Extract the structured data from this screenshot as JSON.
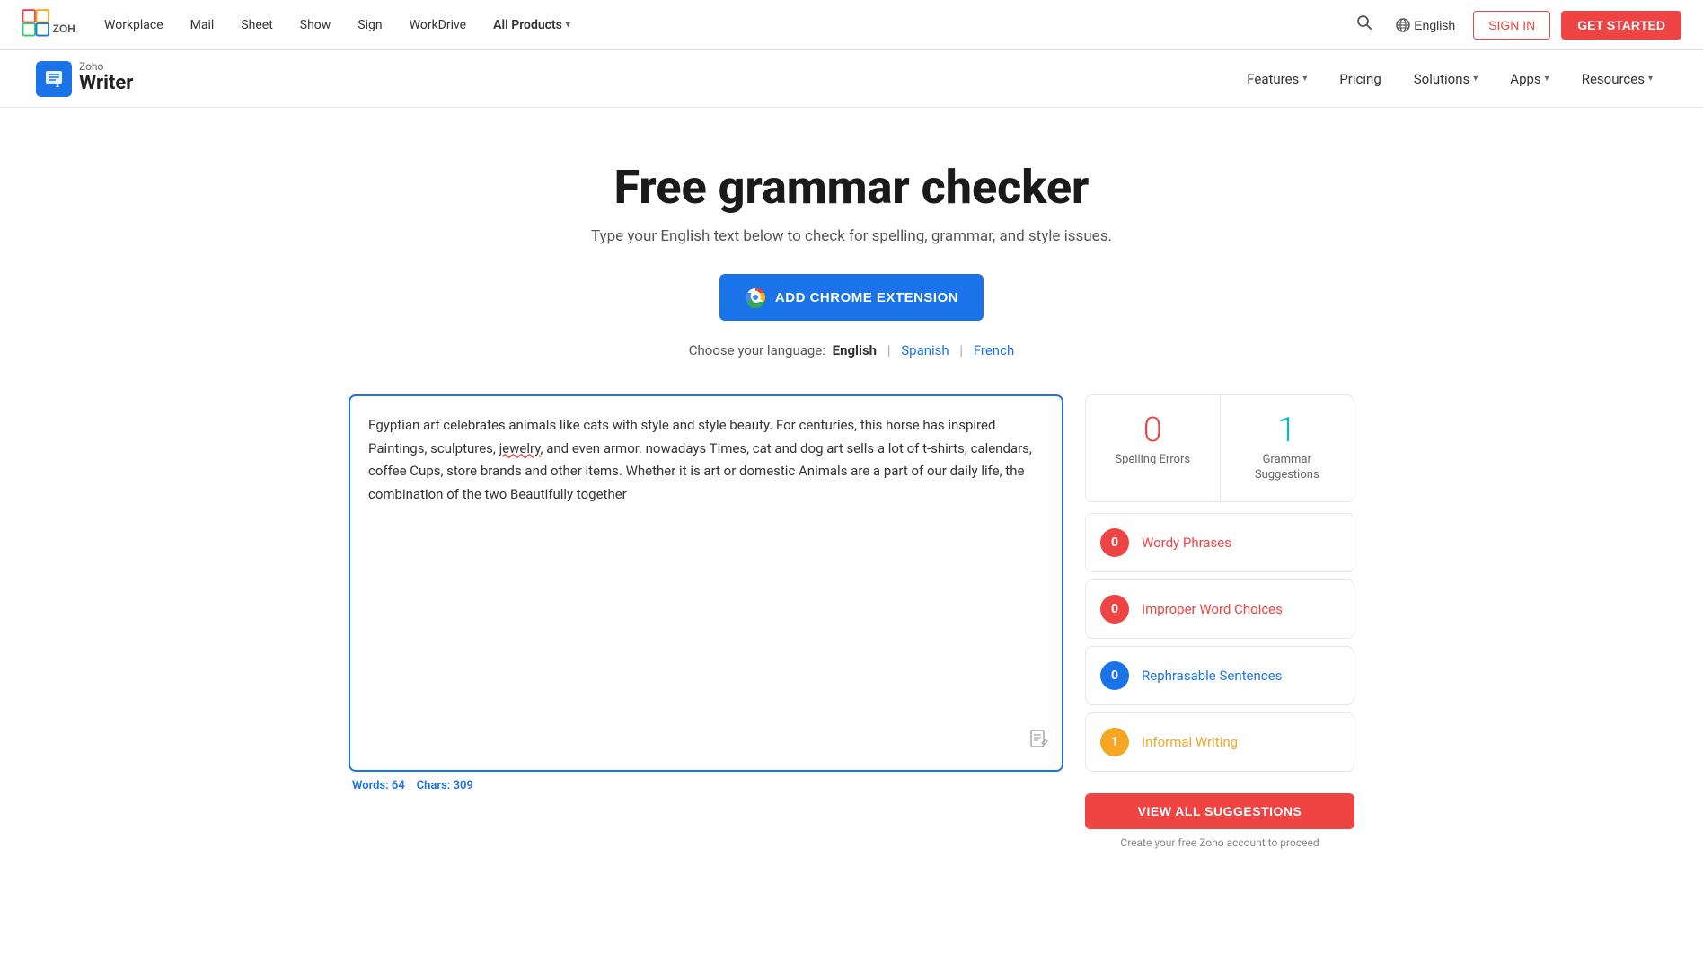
{
  "topNav": {
    "links": [
      {
        "id": "workplace",
        "label": "Workplace"
      },
      {
        "id": "mail",
        "label": "Mail"
      },
      {
        "id": "sheet",
        "label": "Sheet"
      },
      {
        "id": "show",
        "label": "Show"
      },
      {
        "id": "sign",
        "label": "Sign"
      },
      {
        "id": "workdrive",
        "label": "WorkDrive"
      },
      {
        "id": "all-products",
        "label": "All Products",
        "hasChevron": true
      }
    ],
    "searchLabel": "Search",
    "langLabel": "English",
    "signInLabel": "SIGN IN",
    "getStartedLabel": "GET STARTED"
  },
  "secondNav": {
    "brandZoho": "Zoho",
    "brandName": "Writer",
    "links": [
      {
        "id": "features",
        "label": "Features",
        "hasChevron": true
      },
      {
        "id": "pricing",
        "label": "Pricing"
      },
      {
        "id": "solutions",
        "label": "Solutions",
        "hasChevron": true
      },
      {
        "id": "apps",
        "label": "Apps",
        "hasChevron": true
      },
      {
        "id": "resources",
        "label": "Resources",
        "hasChevron": true
      }
    ]
  },
  "hero": {
    "title": "Free grammar checker",
    "subtitle": "Type your English text below to check for spelling, grammar, and style issues.",
    "chromeExtLabel": "ADD CHROME EXTENSION",
    "languageSelectorLabel": "Choose your language:",
    "selectedLang": "English",
    "otherLangs": [
      {
        "id": "spanish",
        "label": "Spanish"
      },
      {
        "id": "french",
        "label": "French"
      }
    ]
  },
  "editor": {
    "content": "Egyptian art celebrates animals like cats with style and style beauty. For centuries, this horse has inspired Paintings, sculptures, jewelry, and even armor. nowadays Times, cat and dog art sells a lot of t-shirts, calendars, coffee Cups, store brands and other items. Whether it is art or domestic Animals are a part of our daily life, the combination of the two Beautifully together",
    "wordCount": "64",
    "charCount": "309",
    "wordsLabel": "Words:",
    "charsLabel": "Chars:"
  },
  "stats": {
    "spellingErrors": "0",
    "spellingLabel": "Spelling Errors",
    "grammarSuggestions": "1",
    "grammarLabel": "Grammar Suggestions"
  },
  "suggestions": [
    {
      "id": "wordy",
      "count": "0",
      "label": "Wordy Phrases",
      "colorClass": "red",
      "labelClass": ""
    },
    {
      "id": "improper",
      "count": "0",
      "label": "Improper Word Choices",
      "colorClass": "red",
      "labelClass": ""
    },
    {
      "id": "rephrasable",
      "count": "0",
      "label": "Rephrasable Sentences",
      "colorClass": "blue",
      "labelClass": "blue-text"
    },
    {
      "id": "informal",
      "count": "1",
      "label": "Informal Writing",
      "colorClass": "orange",
      "labelClass": "orange-text"
    }
  ],
  "viewAllLabel": "VIEW ALL SUGGESTIONS",
  "createAccountNote": "Create your free Zoho account to proceed"
}
